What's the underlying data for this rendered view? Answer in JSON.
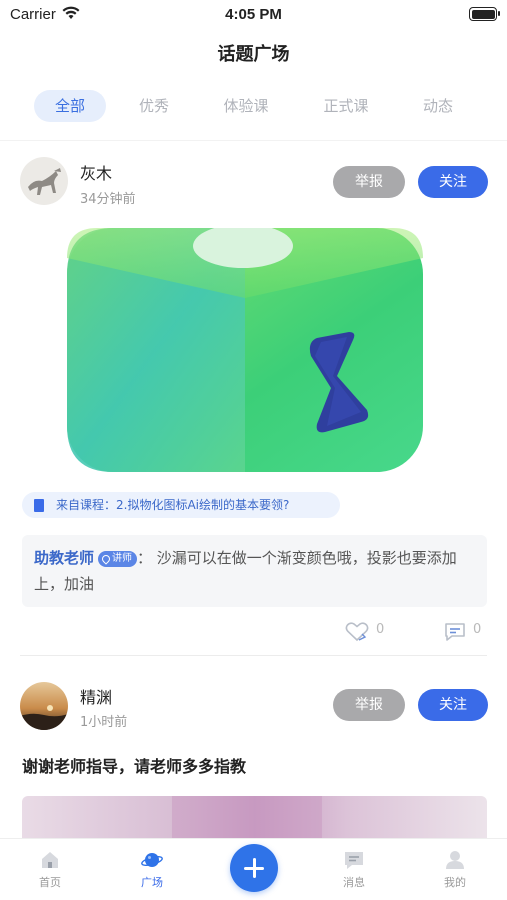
{
  "status_bar": {
    "carrier": "Carrier",
    "time": "4:05 PM"
  },
  "nav": {
    "title": "话题广场"
  },
  "tabs": [
    {
      "label": "全部",
      "active": true
    },
    {
      "label": "优秀",
      "active": false
    },
    {
      "label": "体验课",
      "active": false
    },
    {
      "label": "正式课",
      "active": false
    },
    {
      "label": "动态",
      "active": false
    }
  ],
  "posts": [
    {
      "user": "灰木",
      "time": "34分钟前",
      "report_label": "举报",
      "follow_label": "关注",
      "course_tag": "来自课程：2.拟物化图标Ai绘制的基本要领?",
      "comment": {
        "author": "助教老师",
        "badge": "讲师",
        "text": "：  沙漏可以在做一个渐变颜色哦，投影也要添加上，加油"
      },
      "likes": "0",
      "comments": "0"
    },
    {
      "user": "精渊",
      "time": "1小时前",
      "report_label": "举报",
      "follow_label": "关注",
      "text": "谢谢老师指导，请老师多多指教"
    }
  ],
  "tabbar": {
    "items": [
      {
        "label": "首页",
        "icon": "home-icon"
      },
      {
        "label": "广场",
        "icon": "planet-icon",
        "active": true
      },
      {
        "label": "消息",
        "icon": "message-icon"
      },
      {
        "label": "我的",
        "icon": "profile-icon"
      }
    ]
  },
  "colors": {
    "accent": "#3a6be8",
    "report_button": "#a9a9ab"
  }
}
